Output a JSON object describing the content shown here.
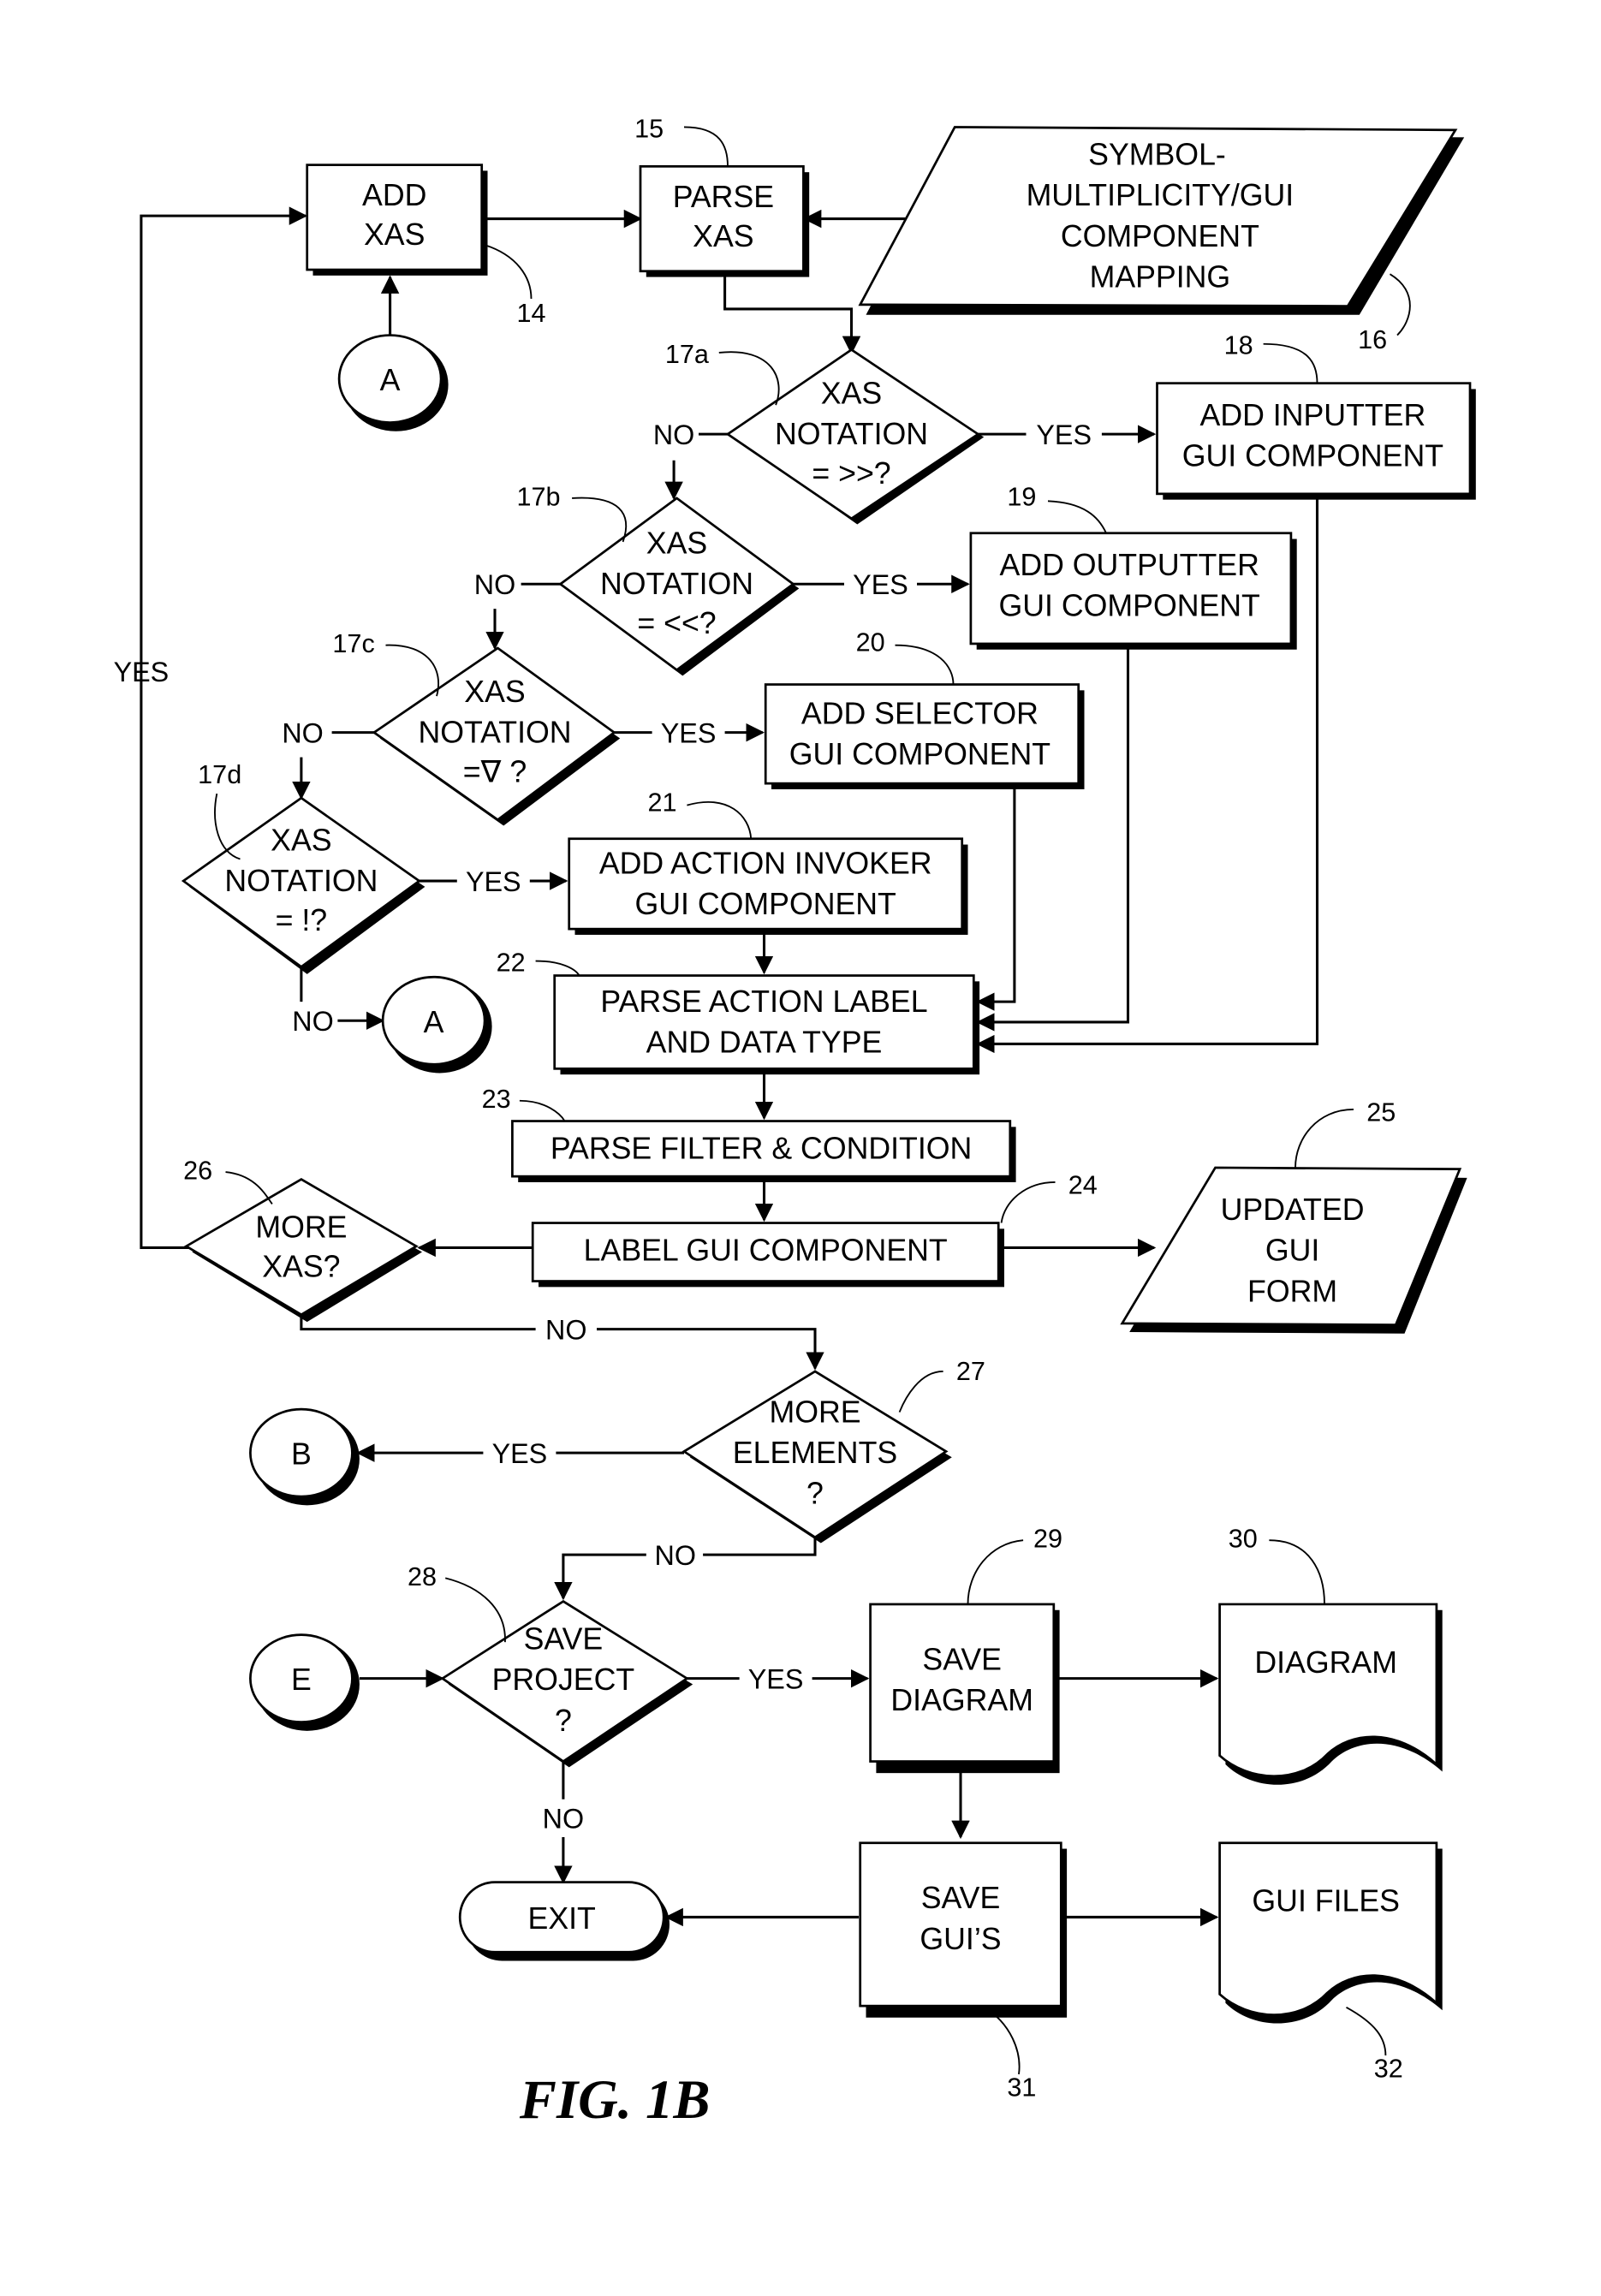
{
  "figure_title": "FIG. 1B",
  "nodes": {
    "add_xas": {
      "ref": "14",
      "lines": [
        "ADD",
        "XAS"
      ]
    },
    "parse_xas": {
      "ref": "15",
      "lines": [
        "PARSE",
        "XAS"
      ]
    },
    "mapping": {
      "ref": "16",
      "lines": [
        "SYMBOL-",
        "MULTIPLICITY/GUI",
        "COMPONENT",
        "MAPPING"
      ]
    },
    "dec_17a": {
      "ref": "17a",
      "lines": [
        "XAS",
        "NOTATION",
        "= >>?"
      ]
    },
    "dec_17b": {
      "ref": "17b",
      "lines": [
        "XAS",
        "NOTATION",
        "= <<?"
      ]
    },
    "dec_17c": {
      "ref": "17c",
      "lines": [
        "XAS",
        "NOTATION",
        "=∇ ?"
      ]
    },
    "dec_17d": {
      "ref": "17d",
      "lines": [
        "XAS",
        "NOTATION",
        "= !?"
      ]
    },
    "inputter": {
      "ref": "18",
      "lines": [
        "ADD INPUTTER",
        "GUI COMPONENT"
      ]
    },
    "outputter": {
      "ref": "19",
      "lines": [
        "ADD OUTPUTTER",
        "GUI COMPONENT"
      ]
    },
    "selector": {
      "ref": "20",
      "lines": [
        "ADD SELECTOR",
        "GUI COMPONENT"
      ]
    },
    "invoker": {
      "ref": "21",
      "lines": [
        "ADD ACTION INVOKER",
        "GUI COMPONENT"
      ]
    },
    "parse_label": {
      "ref": "22",
      "lines": [
        "PARSE ACTION LABEL",
        "AND DATA TYPE"
      ]
    },
    "parse_filter": {
      "ref": "23",
      "lines": [
        "PARSE FILTER & CONDITION"
      ]
    },
    "label_gui": {
      "ref": "24",
      "lines": [
        "LABEL GUI COMPONENT"
      ]
    },
    "updated_form": {
      "ref": "25",
      "lines": [
        "UPDATED",
        "GUI",
        "FORM"
      ]
    },
    "more_xas": {
      "ref": "26",
      "lines": [
        "MORE",
        "XAS?"
      ]
    },
    "more_elements": {
      "ref": "27",
      "lines": [
        "MORE",
        "ELEMENTS",
        "?"
      ]
    },
    "save_project": {
      "ref": "28",
      "lines": [
        "SAVE",
        "PROJECT",
        "?"
      ]
    },
    "save_diagram": {
      "ref": "29",
      "lines": [
        "SAVE",
        "DIAGRAM"
      ]
    },
    "diagram_doc": {
      "ref": "30",
      "lines": [
        "DIAGRAM"
      ]
    },
    "save_guis": {
      "ref": "31",
      "lines": [
        "SAVE",
        "GUI’S"
      ]
    },
    "gui_files": {
      "ref": "32",
      "lines": [
        "GUI FILES"
      ]
    },
    "exit": {
      "lines": [
        "EXIT"
      ]
    },
    "connector_a_top": {
      "lines": [
        "A"
      ]
    },
    "connector_a_bottom": {
      "lines": [
        "A"
      ]
    },
    "connector_b": {
      "lines": [
        "B"
      ]
    },
    "connector_e": {
      "lines": [
        "E"
      ]
    }
  },
  "edge_labels": {
    "yes": "YES",
    "no": "NO"
  }
}
